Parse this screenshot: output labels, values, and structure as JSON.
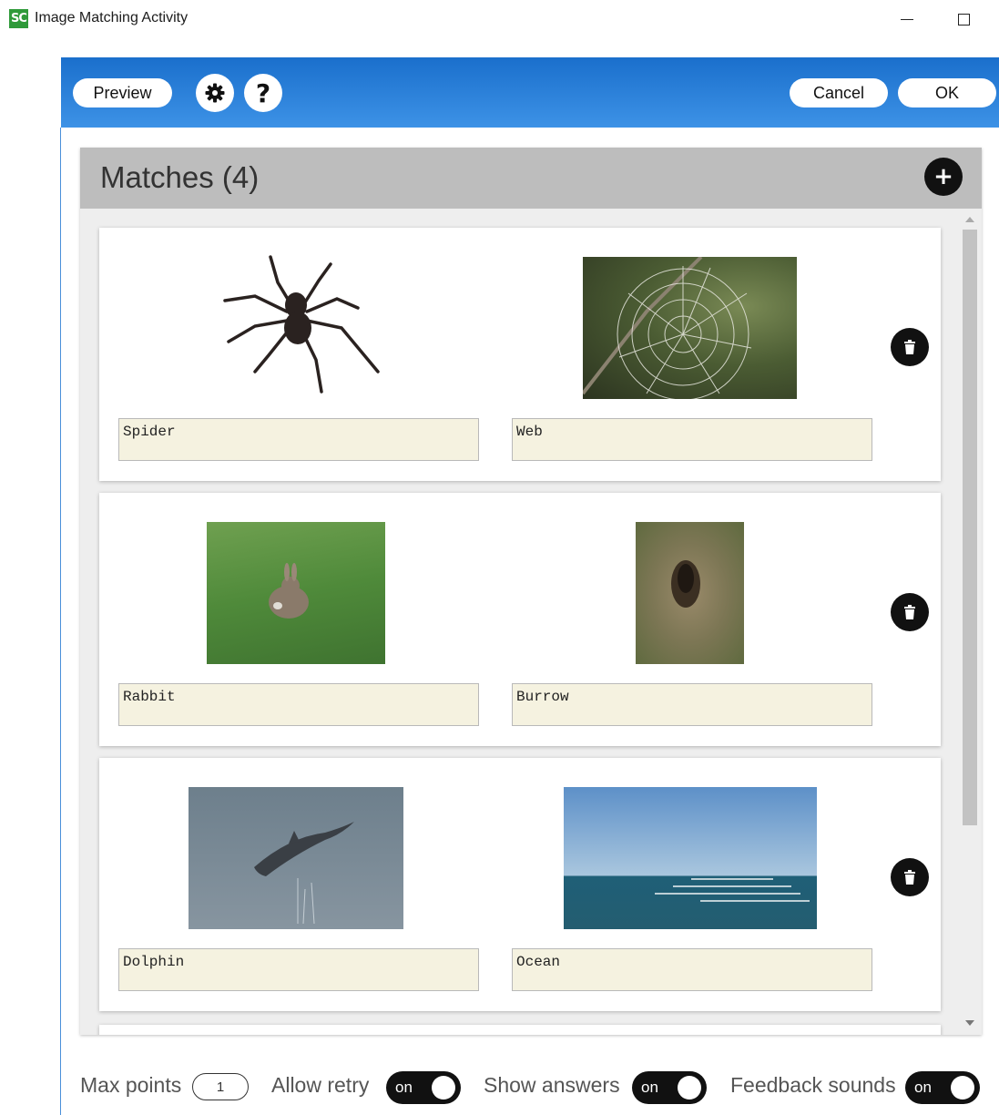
{
  "window": {
    "app_icon_text": "SC",
    "title": "Image Matching Activity"
  },
  "toolbar": {
    "preview_label": "Preview",
    "cancel_label": "Cancel",
    "ok_label": "OK",
    "help_glyph": "?"
  },
  "panel": {
    "title": "Matches (4)",
    "add_glyph": "+"
  },
  "matches": [
    {
      "left_label": "Spider",
      "right_label": "Web"
    },
    {
      "left_label": "Rabbit",
      "right_label": "Burrow"
    },
    {
      "left_label": "Dolphin",
      "right_label": "Ocean"
    }
  ],
  "footer": {
    "max_points_label": "Max points",
    "max_points_value": "1",
    "allow_retry_label": "Allow retry",
    "allow_retry_state": "on",
    "show_answers_label": "Show answers",
    "show_answers_state": "on",
    "feedback_sounds_label": "Feedback sounds",
    "feedback_sounds_state": "on"
  },
  "colors": {
    "toolbar_top": "#1a6fcc",
    "toolbar_bottom": "#3d92e6",
    "field_bg": "#f5f2e0",
    "header_bg": "#bdbdbd"
  }
}
